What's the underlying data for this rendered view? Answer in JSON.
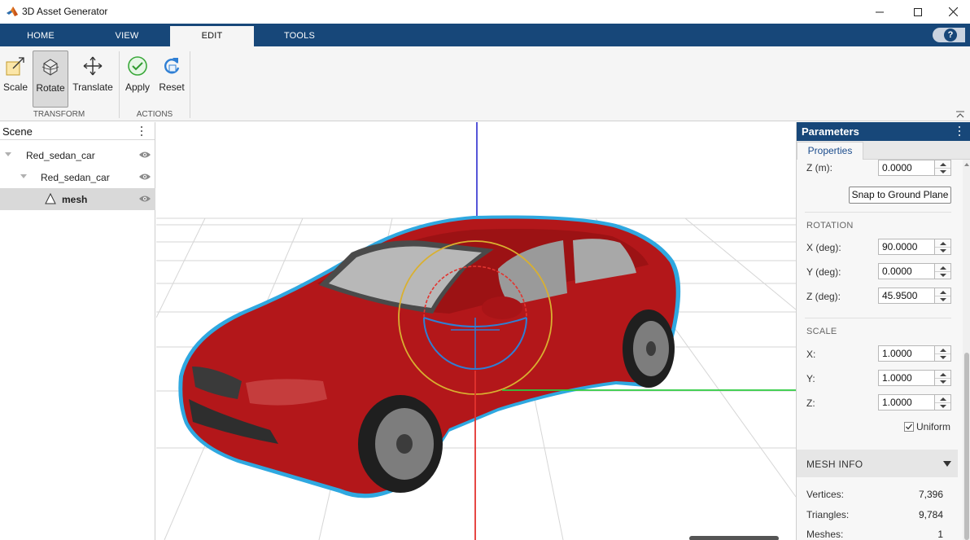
{
  "window": {
    "title": "3D Asset Generator"
  },
  "ribbon": {
    "tabs": [
      {
        "label": "HOME"
      },
      {
        "label": "VIEW"
      },
      {
        "label": "EDIT"
      },
      {
        "label": "TOOLS"
      }
    ],
    "active_tab": "EDIT",
    "help_label": "?"
  },
  "toolstrip": {
    "groups": [
      {
        "label": "TRANSFORM",
        "tools": [
          {
            "label": "Scale",
            "icon": "scale-icon"
          },
          {
            "label": "Rotate",
            "icon": "rotate-icon",
            "active": true
          },
          {
            "label": "Translate",
            "icon": "translate-icon"
          }
        ]
      },
      {
        "label": "ACTIONS",
        "tools": [
          {
            "label": "Apply",
            "icon": "apply-check-icon"
          },
          {
            "label": "Reset",
            "icon": "reset-icon"
          }
        ]
      }
    ]
  },
  "scene": {
    "title": "Scene",
    "items": [
      {
        "name": "Red_sedan_car",
        "level": 0
      },
      {
        "name": "Red_sedan_car",
        "level": 1
      },
      {
        "name": "mesh",
        "level": 2,
        "selected": true
      }
    ]
  },
  "viewport": {
    "colors": {
      "x_axis": "#2ecc40",
      "y_axis": "#e3342f",
      "z_axis": "#1f1fcc",
      "selection_outline": "#2fa8e0",
      "car_body": "#b3171a"
    }
  },
  "parameters": {
    "title": "Parameters",
    "tab": "Properties",
    "position": {
      "z_label": "Z (m):",
      "z_value": "0.0000",
      "snap_button": "Snap to Ground Plane"
    },
    "rotation": {
      "title": "ROTATION",
      "x_label": "X (deg):",
      "x_value": "90.0000",
      "y_label": "Y (deg):",
      "y_value": "0.0000",
      "z_label": "Z (deg):",
      "z_value": "45.9500"
    },
    "scale": {
      "title": "SCALE",
      "x_label": "X:",
      "x_value": "1.0000",
      "y_label": "Y:",
      "y_value": "1.0000",
      "z_label": "Z:",
      "z_value": "1.0000",
      "uniform_label": "Uniform",
      "uniform_checked": true
    },
    "mesh_info": {
      "title": "MESH INFO",
      "vertices_label": "Vertices:",
      "vertices": "7,396",
      "triangles_label": "Triangles:",
      "triangles": "9,784",
      "meshes_label": "Meshes:",
      "meshes": "1"
    }
  }
}
